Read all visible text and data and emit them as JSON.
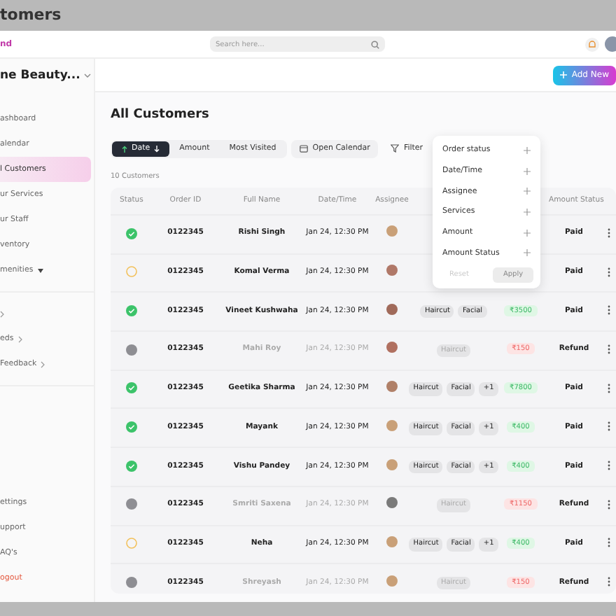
{
  "window": {
    "title": "tomers"
  },
  "header": {
    "brand": "nd",
    "search": {
      "placeholder": "Search here..."
    }
  },
  "sidebar": {
    "workspace": "ne Beauty...",
    "items": [
      {
        "label": "ashboard",
        "selected": false,
        "kind": "nav"
      },
      {
        "label": "alendar",
        "selected": false,
        "kind": "nav"
      },
      {
        "label": "l Customers",
        "selected": true,
        "kind": "nav"
      },
      {
        "label": "ur Services",
        "selected": false,
        "kind": "nav"
      },
      {
        "label": "ur Staff",
        "selected": false,
        "kind": "nav"
      },
      {
        "label": "ventory",
        "selected": false,
        "kind": "nav"
      },
      {
        "label": "menities",
        "selected": false,
        "kind": "caret"
      }
    ],
    "more_items": [
      {
        "kind": "chevron"
      },
      {
        "label": "eds",
        "kind": "chevron"
      },
      {
        "label": "Feedback",
        "kind": "chevron"
      }
    ],
    "bottom_items": [
      {
        "label": "ettings",
        "kind": "nav"
      },
      {
        "label": "upport",
        "kind": "nav"
      },
      {
        "label": "AQ's",
        "kind": "nav"
      },
      {
        "label": "ogout",
        "kind": "danger"
      }
    ]
  },
  "add_button": "Add New",
  "page_title": "All Customers",
  "sort_tabs": [
    {
      "label": "Date",
      "selected": true
    },
    {
      "label": "Amount",
      "selected": false
    },
    {
      "label": "Most Visited",
      "selected": false
    }
  ],
  "calendar_button": "Open Calendar",
  "filter_button": "Filter",
  "count": "10 Customers",
  "columns": [
    "Status",
    "Order ID",
    "Full Name",
    "Date/Time",
    "Assignee",
    "Amount Status"
  ],
  "rows": [
    {
      "kind": "done",
      "order_id": "0122345",
      "name": "Rishi Singh",
      "datetime": "Jan 24, 12:30 PM",
      "amount_status": "Paid"
    },
    {
      "kind": "pending",
      "order_id": "0122345",
      "name": "Komal Verma",
      "datetime": "Jan 24, 12:30 PM",
      "amount_status": "Paid"
    },
    {
      "kind": "done",
      "order_id": "0122345",
      "name": "Vineet Kushwaha",
      "datetime": "Jan 24, 12:30 PM",
      "services": [
        "Haircut",
        "Facial"
      ],
      "amount": "₹3500",
      "amount_status": "Paid"
    },
    {
      "kind": "cancelled",
      "order_id": "0122345",
      "name": "Mahi Roy",
      "datetime": "Jan 24, 12:30 PM",
      "services": [
        "Haircut"
      ],
      "amount": "₹150",
      "amount_status": "Refund"
    },
    {
      "kind": "done",
      "order_id": "0122345",
      "name": "Geetika Sharma",
      "datetime": "Jan 24, 12:30 PM",
      "services": [
        "Haircut",
        "Facial",
        "+1"
      ],
      "amount": "₹7800",
      "amount_status": "Paid"
    },
    {
      "kind": "done",
      "order_id": "0122345",
      "name": "Mayank",
      "datetime": "Jan 24, 12:30 PM",
      "services": [
        "Haircut",
        "Facial",
        "+1"
      ],
      "amount": "₹400",
      "amount_status": "Paid"
    },
    {
      "kind": "done",
      "order_id": "0122345",
      "name": "Vishu Pandey",
      "datetime": "Jan 24, 12:30 PM",
      "services": [
        "Haircut",
        "Facial",
        "+1"
      ],
      "amount": "₹400",
      "amount_status": "Paid"
    },
    {
      "kind": "cancelled",
      "order_id": "0122345",
      "name": "Smriti Saxena",
      "datetime": "Jan 24, 12:30 PM",
      "services": [
        "Haircut"
      ],
      "amount": "₹1150",
      "amount_status": "Refund"
    },
    {
      "kind": "pending",
      "order_id": "0122345",
      "name": "Neha",
      "datetime": "Jan 24, 12:30 PM",
      "services": [
        "Haircut",
        "Facial",
        "+1"
      ],
      "amount": "₹400",
      "amount_status": "Paid"
    },
    {
      "kind": "cancelled",
      "order_id": "0122345",
      "name": "Shreyash",
      "datetime": "Jan 24, 12:30 PM",
      "services": [
        "Haircut"
      ],
      "amount": "₹150",
      "amount_status": "Refund"
    }
  ],
  "filter_menu": {
    "options": [
      "Order status",
      "Date/Time",
      "Assignee",
      "Services",
      "Amount",
      "Amount Status"
    ],
    "reset": "Reset",
    "apply": {
      "label": "Apply",
      "disabled": true
    }
  }
}
